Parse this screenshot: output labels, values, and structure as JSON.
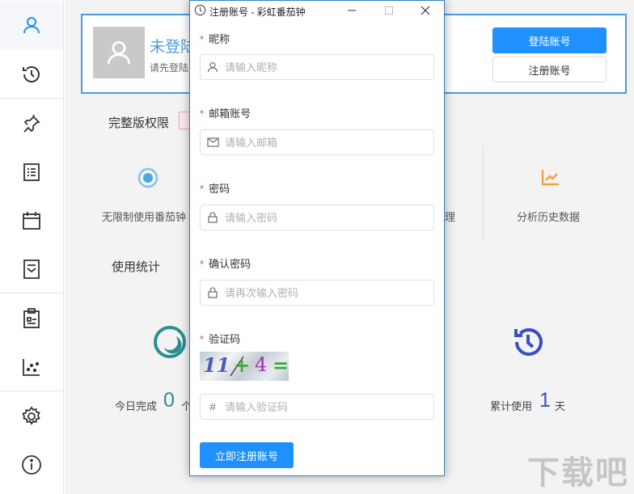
{
  "profile": {
    "name": "未登陆",
    "hint": "请先登陆",
    "login_button": "登陆账号",
    "register_button": "注册账号"
  },
  "sections": {
    "full_version": "完整版权限",
    "usage_stats": "使用统计"
  },
  "features": [
    {
      "label": "无限制使用番茄钟",
      "icon": "target-icon"
    },
    {
      "label": "理",
      "icon": ""
    },
    {
      "label": "分析历史数据",
      "icon": "trend-chart-icon"
    }
  ],
  "stats": {
    "today_prefix": "今日完成",
    "today_value": "0",
    "today_suffix": "个",
    "total_prefix": "累计使用",
    "total_value": "1",
    "total_suffix": "天"
  },
  "sidebar": {
    "items": [
      {
        "name": "user-icon",
        "active": true
      },
      {
        "name": "clock-icon"
      },
      {
        "name": "pin-icon"
      },
      {
        "name": "list-icon"
      },
      {
        "name": "calendar-icon"
      },
      {
        "name": "document-icon"
      },
      {
        "name": "clipboard-icon"
      },
      {
        "name": "scatter-chart-icon"
      },
      {
        "name": "gear-icon"
      },
      {
        "name": "info-icon"
      }
    ]
  },
  "dialog": {
    "title": "注册账号 - 彩虹番茄钟",
    "nickname_label": "昵称",
    "nickname_placeholder": "请输入昵称",
    "email_label": "邮箱账号",
    "email_placeholder": "请输入邮箱",
    "password_label": "密码",
    "password_placeholder": "请输入密码",
    "confirm_label": "确认密码",
    "confirm_placeholder": "请再次输入密码",
    "captcha_label": "验证码",
    "captcha_text": {
      "a": "11",
      "op": "+",
      "b": "4",
      "eq": "="
    },
    "captcha_placeholder": "请输入验证码",
    "submit_button": "立即注册账号",
    "required_mark": "*"
  },
  "watermark": "下载吧",
  "colors": {
    "accent": "#1e90ff",
    "profile_border": "#4a9ae1",
    "teal": "#2a8f8f",
    "history_blue": "#3b4fc4",
    "required": "#e74c3c"
  }
}
